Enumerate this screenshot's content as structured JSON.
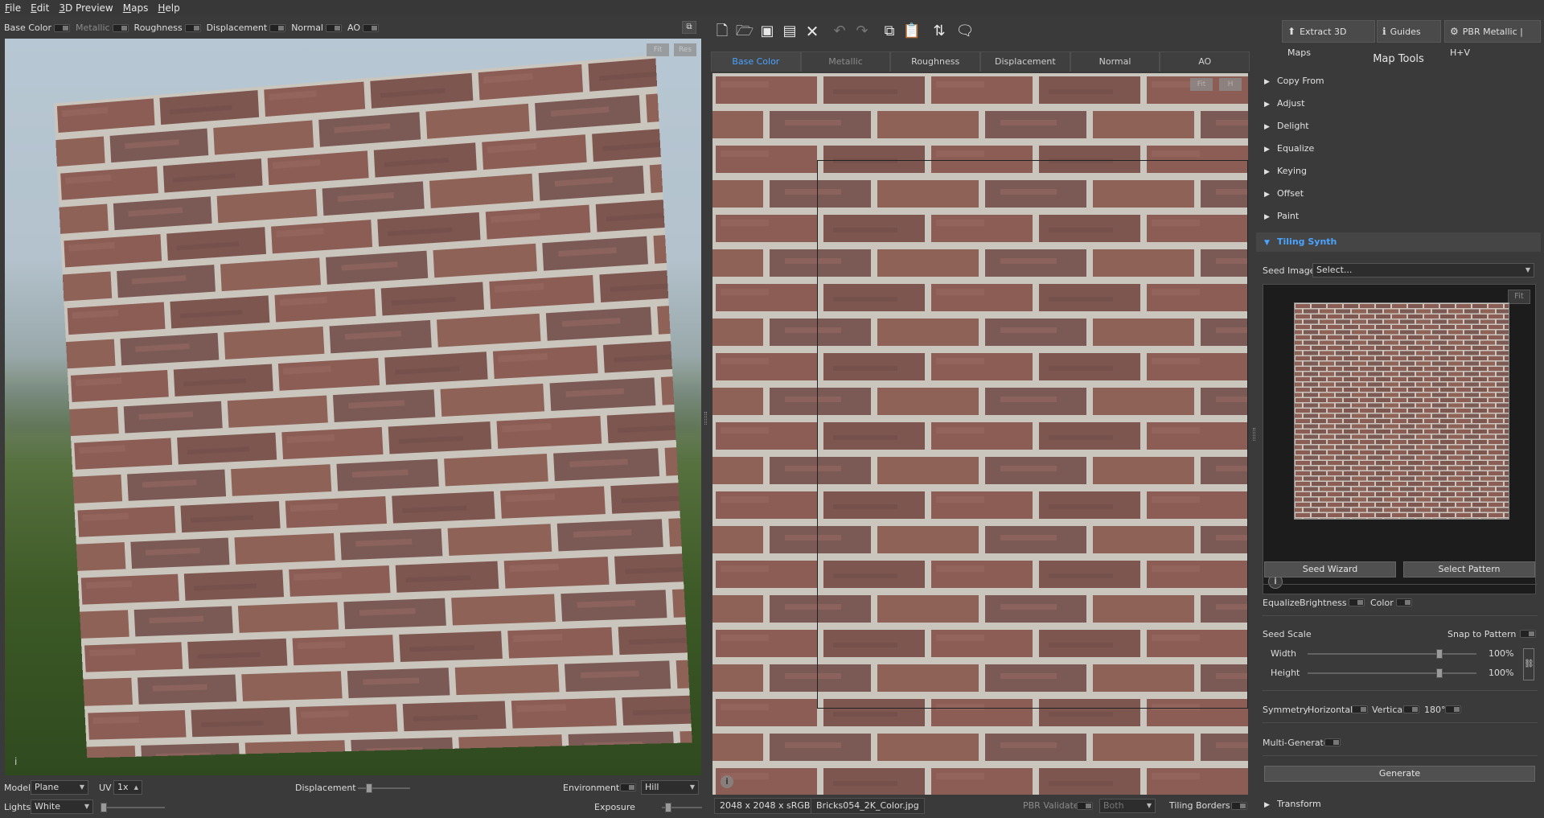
{
  "menu": [
    {
      "first": "F",
      "rest": "ile"
    },
    {
      "first": "E",
      "rest": "dit"
    },
    {
      "first": "3",
      "rest": "D Preview"
    },
    {
      "first": "M",
      "rest": "aps"
    },
    {
      "first": "H",
      "rest": "elp"
    }
  ],
  "left_channels": [
    {
      "label": "Base Color",
      "dim": false
    },
    {
      "label": "Metallic",
      "dim": true
    },
    {
      "label": "Roughness",
      "dim": false
    },
    {
      "label": "Displacement",
      "dim": false
    },
    {
      "label": "Normal",
      "dim": false
    },
    {
      "label": "AO",
      "dim": false
    }
  ],
  "viewport3d": {
    "fit_label": "Fit",
    "res_label": "Res",
    "info": "i"
  },
  "left_bottom": {
    "model_label": "Model",
    "model_value": "Plane",
    "uv_label": "UV",
    "uv_value": "1x",
    "displacement_label": "Displacement",
    "environment_label": "Environment",
    "environment_value": "Hill",
    "lights_label": "Lights",
    "lights_value": "White",
    "exposure_label": "Exposure"
  },
  "toolbar": {
    "extract_label": "Extract 3D Maps",
    "guides_label": "Guides",
    "pbr_label": "PBR Metallic | H+V"
  },
  "tabs": [
    {
      "label": "Base Color",
      "state": "active"
    },
    {
      "label": "Metallic",
      "state": "dim"
    },
    {
      "label": "Roughness",
      "state": "normal"
    },
    {
      "label": "Displacement",
      "state": "normal"
    },
    {
      "label": "Normal",
      "state": "normal"
    },
    {
      "label": "AO",
      "state": "normal"
    }
  ],
  "view2d": {
    "fit_label": "Fit",
    "h_label": "H",
    "info": "i"
  },
  "status2d": {
    "resolution": "2048 x 2048 x sRGB",
    "filename": "Bricks054_2K_Color.jpg",
    "pbr_validate": "PBR Validate",
    "both": "Both",
    "tiling_borders": "Tiling Borders"
  },
  "maptools": {
    "title": "Map Tools",
    "sections": [
      "Copy From",
      "Adjust",
      "Delight",
      "Equalize",
      "Keying",
      "Offset",
      "Paint"
    ],
    "open_section": "Tiling Synth",
    "seed_image_label": "Seed Image",
    "seed_image_value": "Select...",
    "seed_fit": "Fit",
    "seed_info": "i",
    "seed_wizard": "Seed Wizard",
    "select_pattern": "Select Pattern",
    "equalize_label": "Equalize",
    "brightness_label": "Brightness",
    "color_label": "Color",
    "seed_scale_label": "Seed Scale",
    "snap_label": "Snap to Pattern",
    "width_label": "Width",
    "width_value": "100%",
    "height_label": "Height",
    "height_value": "100%",
    "symmetry_label": "Symmetry",
    "horizontal_label": "Horizontal",
    "vertical_label": "Vertical",
    "rot180_label": "180°",
    "multigen_label": "Multi-Generate",
    "generate_label": "Generate",
    "transform_label": "Transform"
  },
  "colors": {
    "accent": "#4aa3ff",
    "brick": "#8a5a52",
    "mortar": "#cfcac2"
  }
}
